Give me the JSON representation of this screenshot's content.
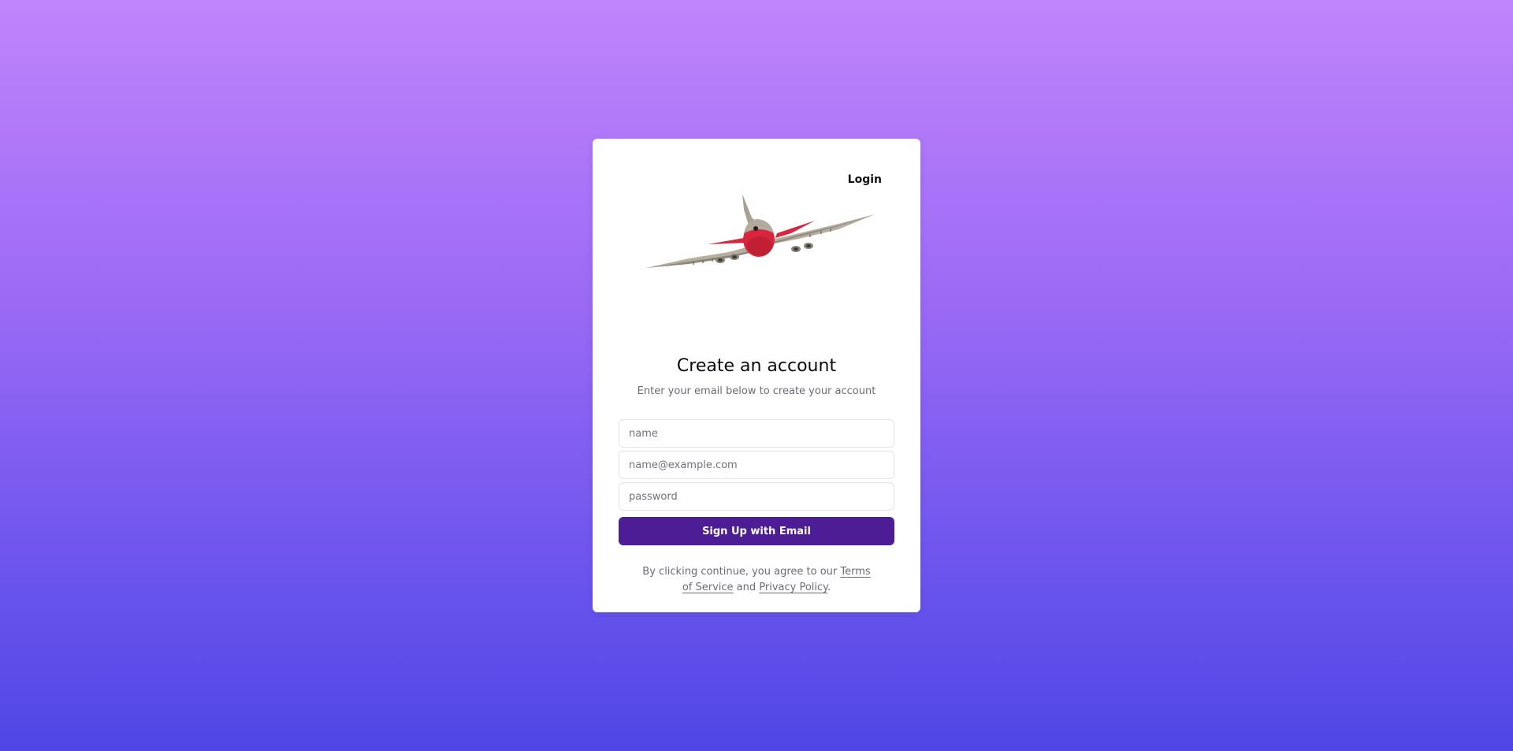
{
  "header": {
    "login_label": "Login"
  },
  "illustration": {
    "icon": "airplane-illustration"
  },
  "form": {
    "title": "Create an account",
    "subtitle": "Enter your email below to create your account",
    "name_placeholder": "name",
    "email_placeholder": "name@example.com",
    "password_placeholder": "password",
    "submit_label": "Sign Up with Email"
  },
  "terms": {
    "prefix": "By clicking continue, you agree to our ",
    "terms_link": "Terms of Service",
    "middle": " and ",
    "privacy_link": "Privacy Policy",
    "suffix": "."
  },
  "colors": {
    "background_top": "#c084fc",
    "background_bottom": "#4f46e5",
    "button": "#4c1d95",
    "plane_body": "#d7263d"
  }
}
